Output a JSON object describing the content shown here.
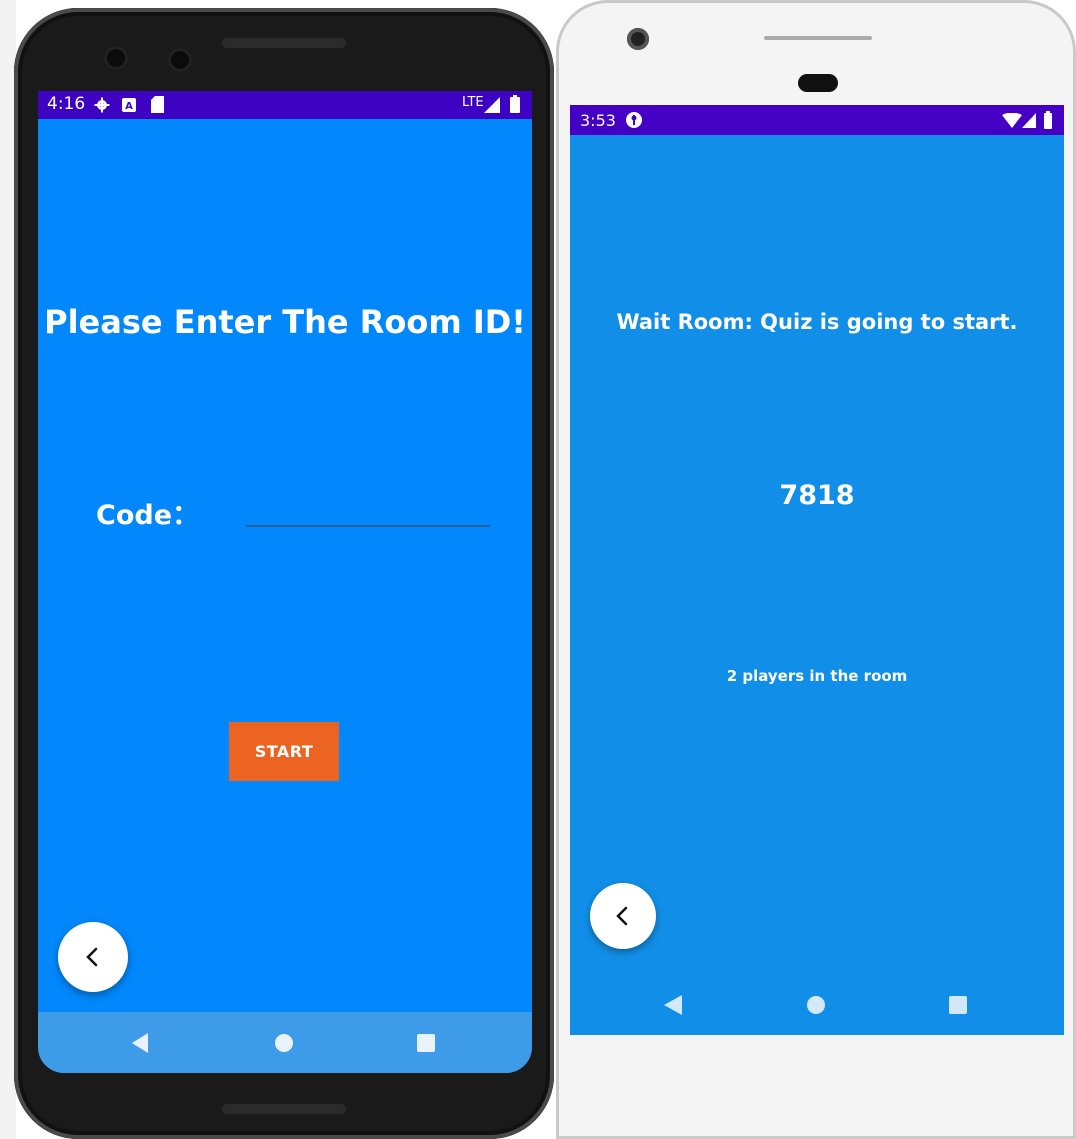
{
  "left_phone": {
    "status_bar": {
      "time": "4:16",
      "network": "LTE"
    },
    "title": "Please Enter The Room ID!",
    "code_label": "Code：",
    "code_input_value": "",
    "start_button": "START",
    "colors": {
      "screen": "#0288fc",
      "status_bar": "#3e02c2",
      "start_button": "#ec6421"
    }
  },
  "right_phone": {
    "status_bar": {
      "time": "3:53"
    },
    "title": "Wait Room: Quiz is going to start.",
    "room_id": "7818",
    "players_text": "2 players in the room",
    "colors": {
      "screen": "#118fe8",
      "status_bar": "#4401c3"
    }
  },
  "icons": [
    "gear-icon",
    "a-badge-icon",
    "sd-card-icon",
    "signal-icon",
    "battery-icon",
    "wifi-icon",
    "back-chevron-icon",
    "nav-back-icon",
    "nav-home-icon",
    "nav-recents-icon"
  ]
}
